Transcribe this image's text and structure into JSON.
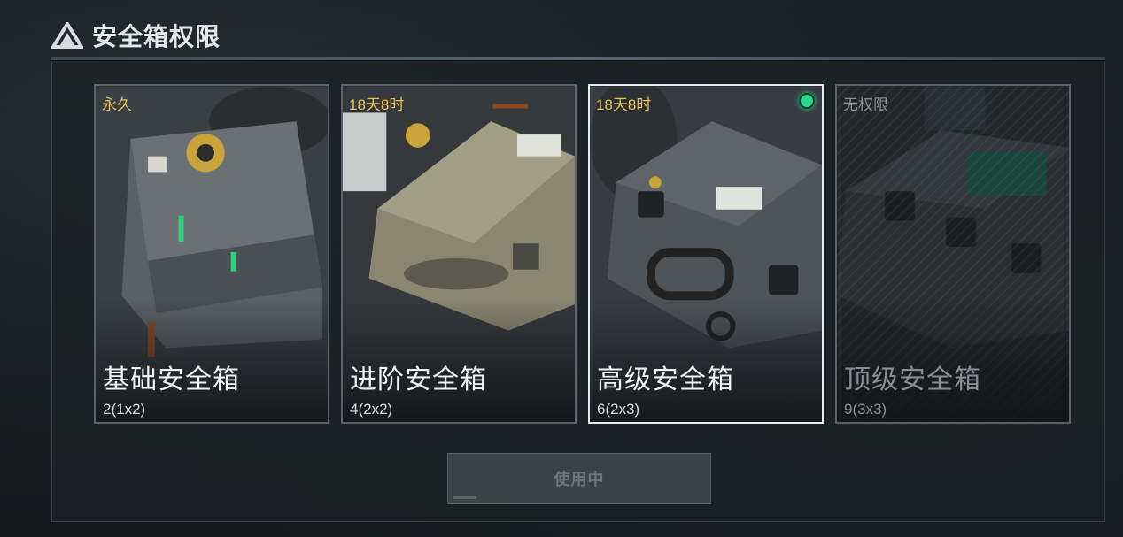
{
  "page": {
    "title": "安全箱权限"
  },
  "cards": [
    {
      "status": "永久",
      "name": "基础安全箱",
      "size": "2(1x2)"
    },
    {
      "status": "18天8时",
      "name": "进阶安全箱",
      "size": "4(2x2)"
    },
    {
      "status": "18天8时",
      "name": "高级安全箱",
      "size": "6(2x3)"
    },
    {
      "status": "无权限",
      "name": "顶级安全箱",
      "size": "9(3x3)"
    }
  ],
  "selected_card": "高级安全箱",
  "action_button": {
    "label": "使用中"
  },
  "colors": {
    "status_active": "#e9c35a",
    "status_none": "#8a8f93",
    "active_indicator": "#27d98b",
    "selected_border": "#e9ecee"
  }
}
